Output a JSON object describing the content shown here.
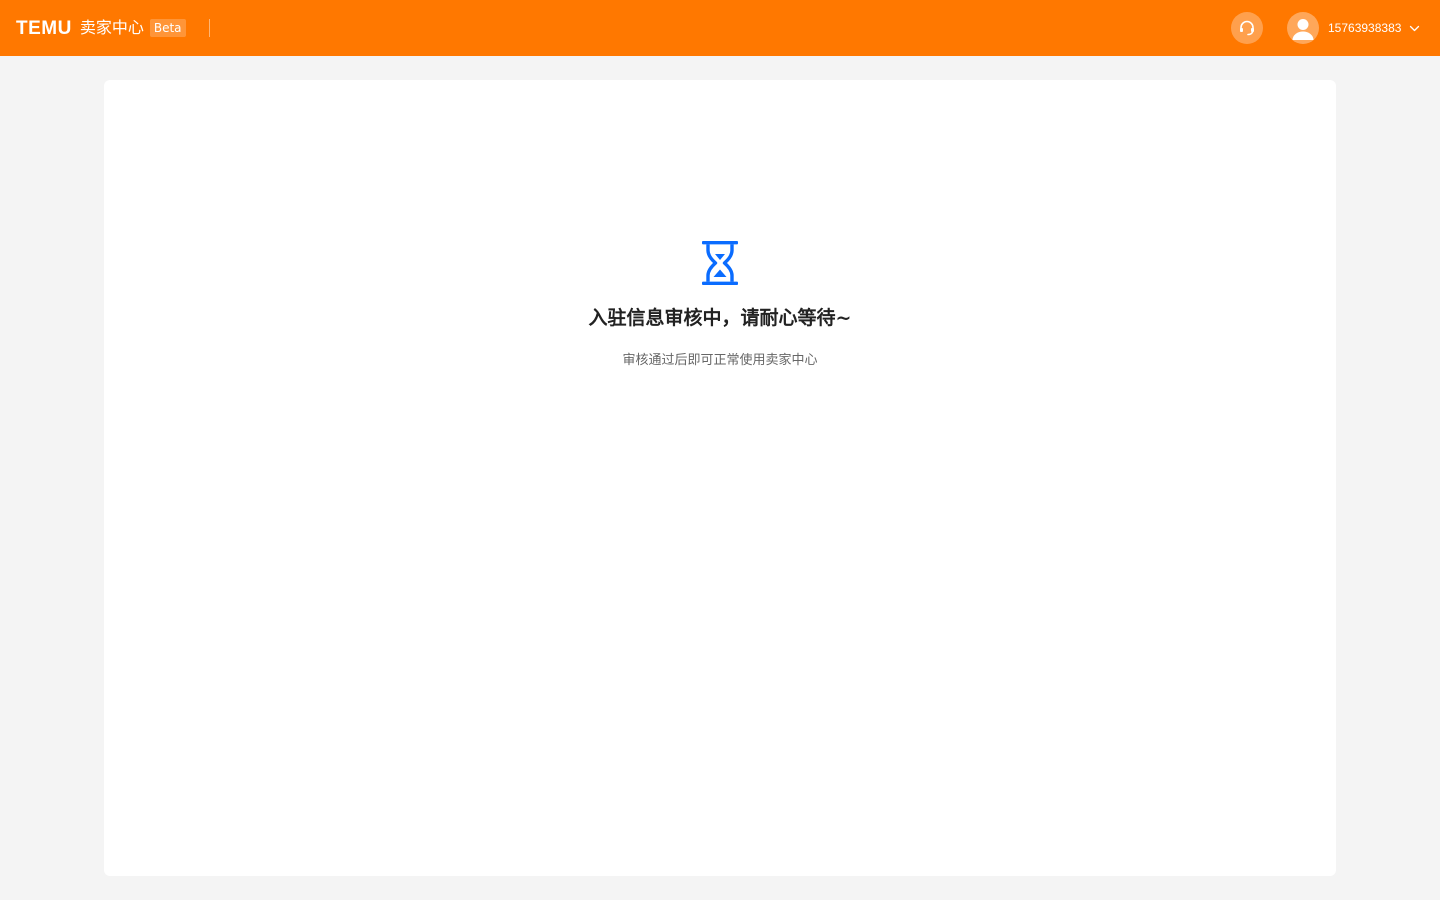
{
  "header": {
    "logo_text": "TEMU",
    "brand_name": "卖家中心",
    "badge": "Beta",
    "support_icon": "headset-icon",
    "avatar_icon": "user-avatar-icon",
    "username": "15763938383",
    "dropdown_icon": "chevron-down-icon",
    "accent_color": "#ff7800"
  },
  "main": {
    "status_icon": "hourglass-icon",
    "status_icon_color": "#0a6cff",
    "title": "入驻信息审核中，请耐心等待~",
    "description": "审核通过后即可正常使用卖家中心"
  }
}
